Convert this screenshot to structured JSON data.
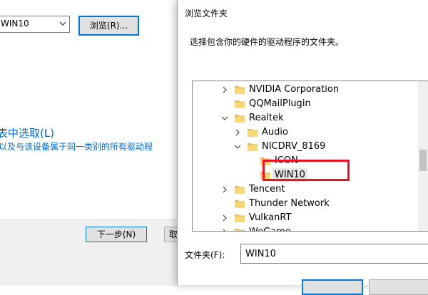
{
  "wizard": {
    "path_value": "WIN10",
    "browse_label": "浏览(R)...",
    "pick_link": "表中选取(L)",
    "pick_desc": "以及与该设备属于同一类别的所有驱动程",
    "next_label": "下一步(N)",
    "cancel_partial": "取"
  },
  "dialog": {
    "title": "浏览文件夹",
    "instruction": "选择包含你的硬件的驱动程序的文件夹。",
    "folder_label": "文件夹(F):",
    "folder_value": "WIN10",
    "tree": [
      {
        "label": "NVIDIA Corporation",
        "expander": "collapsed"
      },
      {
        "label": "QQMailPlugin",
        "expander": "none"
      },
      {
        "label": "Realtek",
        "expander": "expanded"
      },
      {
        "label": "Audio",
        "expander": "collapsed"
      },
      {
        "label": "NICDRV_8169",
        "expander": "expanded"
      },
      {
        "label": "ICON",
        "expander": "none"
      },
      {
        "label": "WIN10",
        "expander": "none",
        "selected": true
      },
      {
        "label": "Tencent",
        "expander": "collapsed"
      },
      {
        "label": "Thunder Network",
        "expander": "none"
      },
      {
        "label": "VulkanRT",
        "expander": "collapsed"
      },
      {
        "label": "WeGame...",
        "expander": "collapsed"
      }
    ]
  },
  "colors": {
    "accent": "#0078d7",
    "link": "#0066cc",
    "highlight": "#e81123",
    "folder": "#f8d775"
  },
  "icons": {
    "folder": "folder-icon",
    "expand": "chevron-right-icon",
    "collapse": "chevron-down-icon",
    "dropdown": "chevron-down-icon"
  }
}
